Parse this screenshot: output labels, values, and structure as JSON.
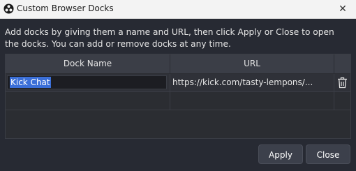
{
  "window": {
    "title": "Custom Browser Docks",
    "app_icon": "obs-logo-icon",
    "close_icon": "close-icon"
  },
  "description": "Add docks by giving them a name and URL, then click Apply or Close to open the docks. You can add or remove docks at any time.",
  "table": {
    "columns": [
      "Dock Name",
      "URL"
    ],
    "rows": [
      {
        "name": "Kick Chat",
        "url": "https://kick.com/tasty-lempons/...",
        "delete_icon": "trash-icon"
      }
    ]
  },
  "buttons": {
    "apply": "Apply",
    "close": "Close"
  },
  "colors": {
    "background": "#272a33",
    "selection": "#3b6fd8",
    "header": "#3b3e47"
  }
}
